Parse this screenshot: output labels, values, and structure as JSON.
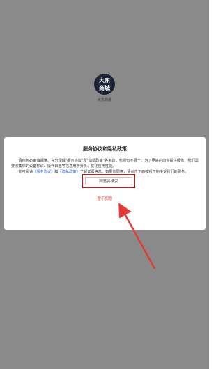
{
  "app": {
    "logo_line1": "大东",
    "logo_line2": "商城",
    "name": "大东商城"
  },
  "dialog": {
    "title": "服务协议和隐私政策",
    "para1": "请你务必审慎阅读、充分理解\"服务协议\"和\"隐私政策\"各条款，包括但不限于：为了更好的向你提供服务，我们需要收集你的设备标识、操作日志等信息用于分析、优化应用性能。",
    "para2_prefix": "你可阅读",
    "link_terms": "《服务协议》",
    "para2_and": "和",
    "link_privacy": "《隐私政策》",
    "para2_suffix": "了解详细信息。如果你同意，请点击下面按钮开始接受我们的服务。",
    "agree_label": "同意并接受",
    "decline_label": "暂不同意"
  },
  "annotation": {
    "arrow_color": "#e53935",
    "highlight_color": "#ff0000"
  }
}
